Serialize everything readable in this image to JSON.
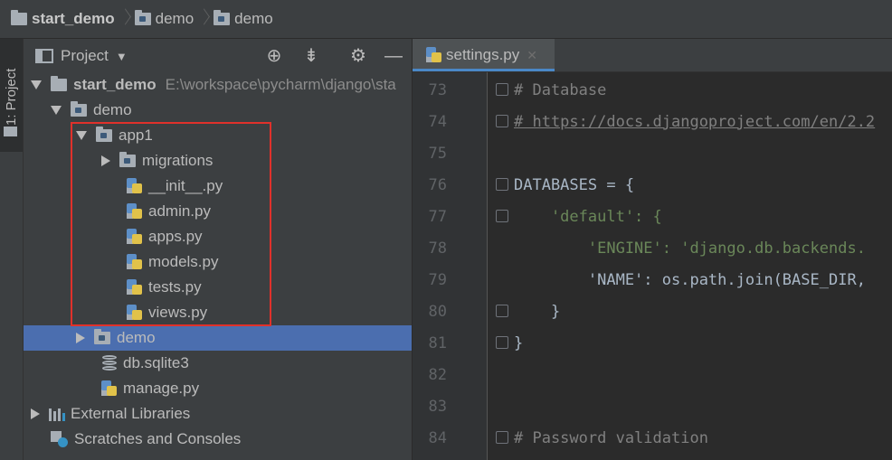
{
  "breadcrumb": [
    "start_demo",
    "demo",
    "demo"
  ],
  "side_stripe": {
    "label": "1: Project"
  },
  "project_panel": {
    "title": "Project",
    "buttons": [
      "target-icon",
      "collapse-icon",
      "gear-icon",
      "hide-icon"
    ]
  },
  "tree": {
    "root": {
      "label": "start_demo",
      "path": "E:\\workspace\\pycharm\\django\\sta"
    },
    "demo_pkg": "demo",
    "app1": "app1",
    "migrations": "migrations",
    "files": [
      "__init__.py",
      "admin.py",
      "apps.py",
      "models.py",
      "tests.py",
      "views.py"
    ],
    "demo_sub": "demo",
    "db": "db.sqlite3",
    "manage": "manage.py",
    "external": "External Libraries",
    "scratches": "Scratches and Consoles"
  },
  "editor": {
    "tab": "settings.py",
    "lines": [
      {
        "n": "73",
        "text": "# Database"
      },
      {
        "n": "74",
        "text": "# https://docs.djangoproject.com/en/2.2"
      },
      {
        "n": "75",
        "text": ""
      },
      {
        "n": "76",
        "text": "DATABASES = {"
      },
      {
        "n": "77",
        "text": "    'default': {"
      },
      {
        "n": "78",
        "text": "        'ENGINE': 'django.db.backends."
      },
      {
        "n": "79",
        "text": "        'NAME': os.path.join(BASE_DIR,"
      },
      {
        "n": "80",
        "text": "    }"
      },
      {
        "n": "81",
        "text": "}"
      },
      {
        "n": "82",
        "text": ""
      },
      {
        "n": "83",
        "text": ""
      },
      {
        "n": "84",
        "text": "# Password validation"
      }
    ]
  }
}
